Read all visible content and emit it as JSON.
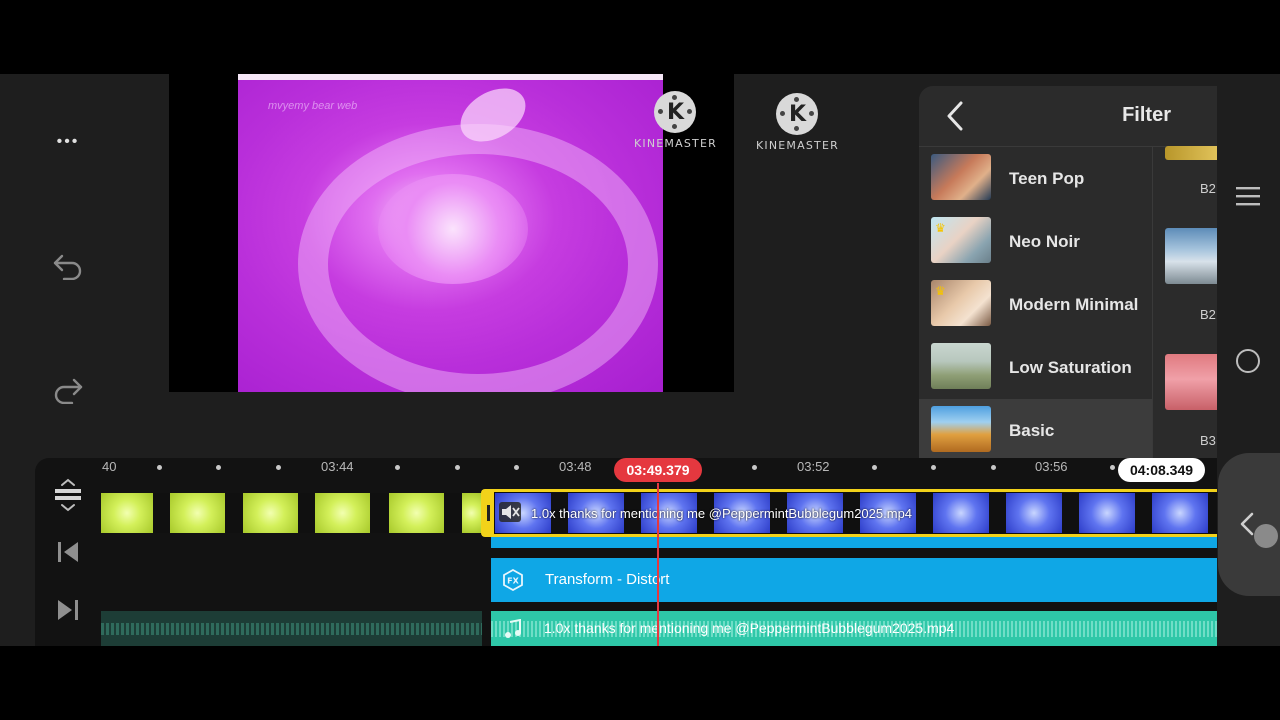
{
  "left_toolbar": {
    "more_label": "•••",
    "undo_icon": "undo-icon",
    "redo_icon": "redo-icon"
  },
  "preview": {
    "watermarks": [
      {
        "text": "KINEMASTER",
        "letter": "K"
      },
      {
        "text": "KINEMASTER",
        "letter": "K"
      }
    ],
    "overlay_text": "mvyemy bear web"
  },
  "filter_panel": {
    "title": "Filter",
    "items": [
      {
        "name": "Teen Pop",
        "premium": false,
        "selected": false
      },
      {
        "name": "Neo Noir",
        "premium": true,
        "selected": false
      },
      {
        "name": "Modern Minimal",
        "premium": true,
        "selected": false
      },
      {
        "name": "Low Saturation",
        "premium": false,
        "selected": false
      },
      {
        "name": "Basic",
        "premium": false,
        "selected": true
      }
    ],
    "sub_items": [
      "B2",
      "B2",
      "B3"
    ]
  },
  "timeline": {
    "ruler": {
      "labels": [
        "40",
        "03:44",
        "03:48",
        "03:52",
        "03:56"
      ],
      "playhead_time": "03:49.379",
      "end_time": "04:08.349"
    },
    "video_clip_name": "1.0x thanks for mentioning me @PeppermintBubblegum2025.mp4",
    "effect_layer_label": "Transform - Distort",
    "audio_clip_name": "1.0x thanks for mentioning me @PeppermintBubblegum2025.mp4"
  },
  "colors": {
    "accent_red": "#e5383f",
    "effect_blue": "#0fa7e6",
    "audio_teal": "#2ec7a8",
    "clip_outline": "#f2d21a"
  }
}
